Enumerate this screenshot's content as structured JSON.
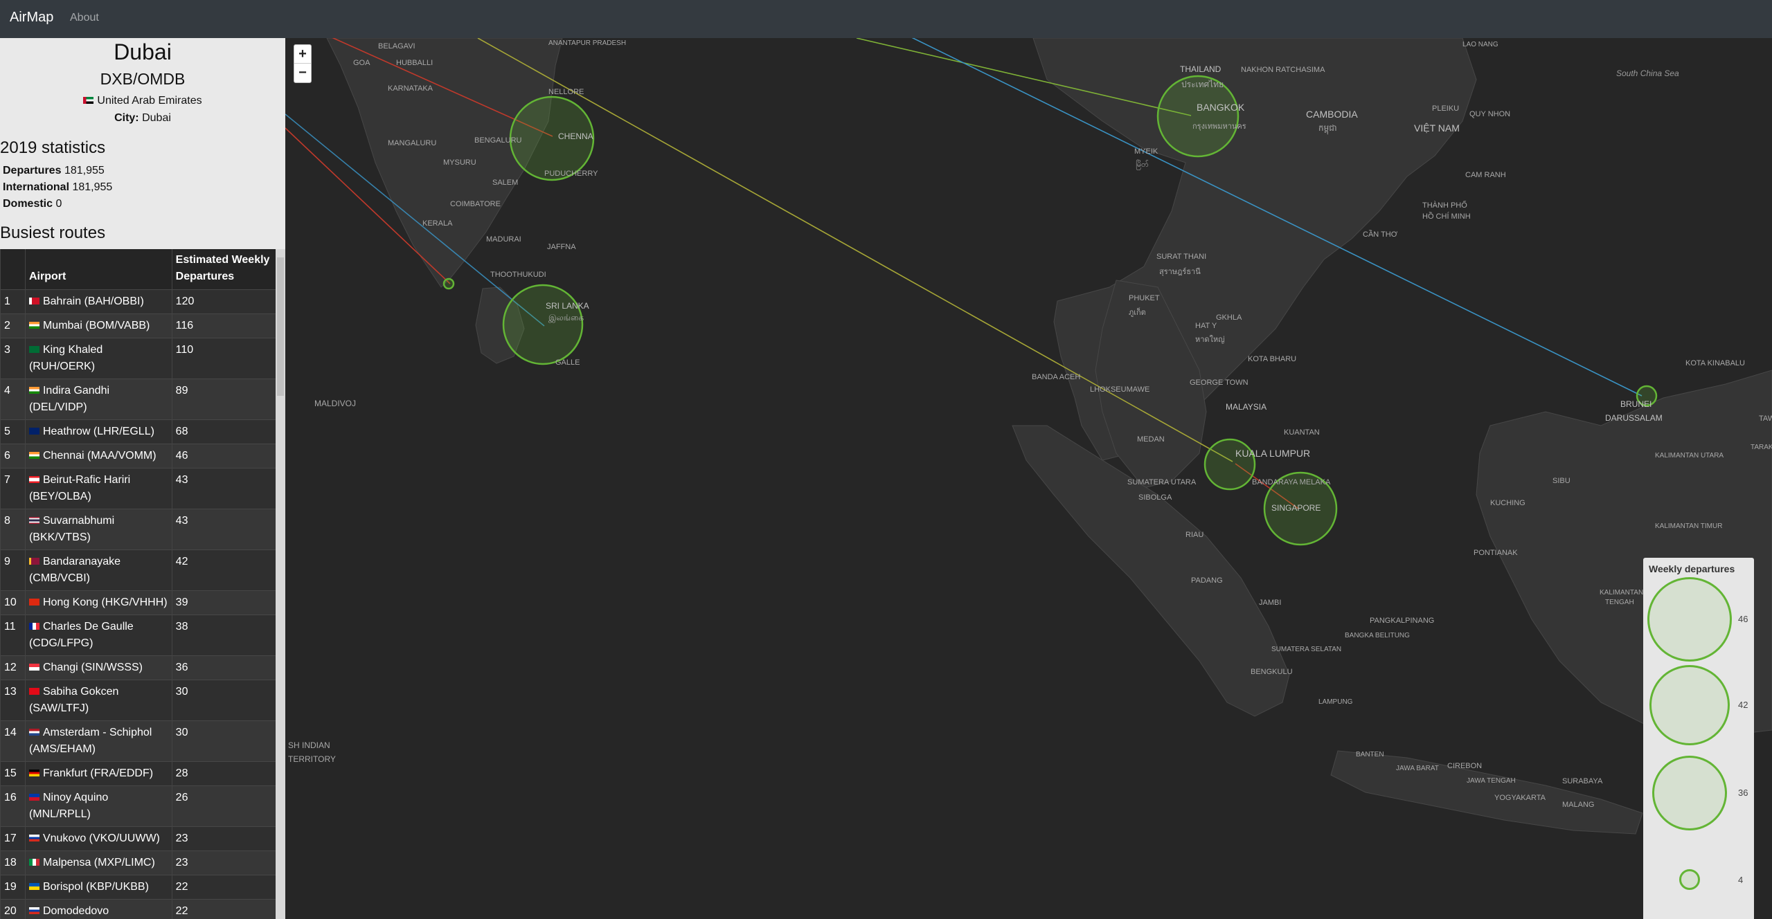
{
  "navbar": {
    "brand": "AirMap",
    "about": "About"
  },
  "airport": {
    "name": "Dubai",
    "codes": "DXB/OMDB",
    "country": "United Arab Emirates",
    "city_label": "City:",
    "city": "Dubai"
  },
  "stats": {
    "title": "2019 statistics",
    "departures_label": "Departures",
    "departures": "181,955",
    "international_label": "International",
    "international": "181,955",
    "domestic_label": "Domestic",
    "domestic": "0"
  },
  "routes": {
    "title": "Busiest routes",
    "col_airport": "Airport",
    "col_departures_1": "Estimated Weekly",
    "col_departures_2": "Departures",
    "rows": [
      {
        "rank": "1",
        "airport": "Bahrain (BAH/OBBI)",
        "departures": "120"
      },
      {
        "rank": "2",
        "airport": "Mumbai (BOM/VABB)",
        "departures": "116"
      },
      {
        "rank": "3",
        "airport": "King Khaled (RUH/OERK)",
        "departures": "110"
      },
      {
        "rank": "4",
        "airport": "Indira Gandhi (DEL/VIDP)",
        "departures": "89"
      },
      {
        "rank": "5",
        "airport": "Heathrow (LHR/EGLL)",
        "departures": "68"
      },
      {
        "rank": "6",
        "airport": "Chennai (MAA/VOMM)",
        "departures": "46"
      },
      {
        "rank": "7",
        "airport": "Beirut-Rafic Hariri (BEY/OLBA)",
        "departures": "43"
      },
      {
        "rank": "8",
        "airport": "Suvarnabhumi (BKK/VTBS)",
        "departures": "43"
      },
      {
        "rank": "9",
        "airport": "Bandaranayake (CMB/VCBI)",
        "departures": "42"
      },
      {
        "rank": "10",
        "airport": "Hong Kong (HKG/VHHH)",
        "departures": "39"
      },
      {
        "rank": "11",
        "airport": "Charles De Gaulle (CDG/LFPG)",
        "departures": "38"
      },
      {
        "rank": "12",
        "airport": "Changi (SIN/WSSS)",
        "departures": "36"
      },
      {
        "rank": "13",
        "airport": "Sabiha Gokcen (SAW/LTFJ)",
        "departures": "30"
      },
      {
        "rank": "14",
        "airport": "Amsterdam - Schiphol (AMS/EHAM)",
        "departures": "30"
      },
      {
        "rank": "15",
        "airport": "Frankfurt (FRA/EDDF)",
        "departures": "28"
      },
      {
        "rank": "16",
        "airport": "Ninoy Aquino (MNL/RPLL)",
        "departures": "26"
      },
      {
        "rank": "17",
        "airport": "Vnukovo (VKO/UUWW)",
        "departures": "23"
      },
      {
        "rank": "18",
        "airport": "Malpensa (MXP/LIMC)",
        "departures": "23"
      },
      {
        "rank": "19",
        "airport": "Borispol (KBP/UKBB)",
        "departures": "22"
      },
      {
        "rank": "20",
        "airport": "Domodedovo (DME/UUDD)",
        "departures": "22"
      }
    ]
  },
  "map": {
    "zoom_in": "+",
    "zoom_out": "−",
    "places": {
      "belagavi": "BELAGAVI",
      "anantapur": "ANANTAPUR PRADESH",
      "goa": "GOA",
      "hubballi": "HUBBALLI",
      "karnataka": "KARNATAKA",
      "nellore": "NELLORE",
      "mangaluru": "MANGALURU",
      "bengaluru": "BENGALURU",
      "chennai": "CHENNA",
      "mysuru": "MYSURU",
      "salem": "SALEM",
      "puducherry": "PUDUCHERRY",
      "coimbatore": "COIMBATORE",
      "kerala": "KERALA",
      "madurai": "MADURAI",
      "jaffna": "JAFFNA",
      "thoothukudi": "THOOTHUKUDI",
      "srilanka": "SRI LANKA",
      "srilanka_local": "இலங்கை",
      "galle": "GALLE",
      "maldivo": "MALDIVOJ",
      "biot1": "SH INDIAN",
      "biot2": "TERRITORY",
      "thailand": "THAILAND",
      "thailand_local": "ประเทศไทย",
      "nakhon": "NAKHON RATCHASIMA",
      "bangkok": "BANGKOK",
      "bangkok_local": "กรุงเทพมหานคร",
      "cambodia": "CAMBODIA",
      "cambodia_local": "កម្ពុជា",
      "pleiku": "PLEIKU",
      "quynhon": "QUY NHON",
      "vietnam": "VIỆT NAM",
      "laos": "LAO NANG",
      "camranh": "CAM RANH",
      "myeik": "MYEIK",
      "myeik_local": "မြိတ်",
      "thanhpho1": "THÀNH PHỐ",
      "thanhpho2": "HỒ CHÍ MINH",
      "canthe": "CẦN THƠ",
      "suratthani": "SURAT THANI",
      "suratthani_local": "สุราษฎร์ธานี",
      "phuket": "PHUKET",
      "phuket_local": "ภูเก็ต",
      "hatyai": "HAT Y",
      "hatyai_local": "หาดใหญ่",
      "songkhla": "GKHLA",
      "kotabharu": "KOTA BHARU",
      "georgetown": "GEORGE TOWN",
      "malaysia": "MALAYSIA",
      "bandaaceh": "BANDA ACEH",
      "lhokseumawe": "LHOKSEUMAWE",
      "kuantan": "KUANTAN",
      "medan": "MEDAN",
      "kualalumpur": "KUALA LUMPUR",
      "bandaraya": "BANDARAYA MELAKA",
      "singapore": "SINGAPORE",
      "sumatera_utara": "SUMATERA UTARA",
      "sibolga": "SIBOLGA",
      "riau": "RIAU",
      "padang": "PADANG",
      "jambi": "JAMBI",
      "pangkalpinang": "PANGKALPINANG",
      "bangka": "BANGKA BELITUNG",
      "sumatera_selatan": "SUMATERA SELATAN",
      "bengkulu": "BENGKULU",
      "lampung": "LAMPUNG",
      "banten": "BANTEN",
      "cirebon": "CIREBON",
      "jawabarat": "JAWA BARAT",
      "jawatengah": "JAWA TENGAH",
      "surabaya": "SURABAYA",
      "yogyakarta": "YOGYAKARTA",
      "malang": "MALANG",
      "southchinasea": "South China Sea",
      "brunei": "BRUNEI",
      "darussalam": "DARUSSALAM",
      "kotakinabalu": "KOTA KINABALU",
      "kalimantan_utara": "KALIMANTAN UTARA",
      "sibu": "SIBU",
      "kuching": "KUCHING",
      "kalimantan_timur": "KALIMANTAN TIMUR",
      "pontianak": "PONTIANAK",
      "kalimantan_tengah1": "KALIMANTAN",
      "kalimantan_tengah2": "TENGAH",
      "tawau": "TAWA",
      "tarakan": "TARAKAN"
    }
  },
  "legend": {
    "title": "Weekly departures",
    "levels": [
      "46",
      "42",
      "36",
      "4"
    ]
  },
  "colors": {
    "marker": "#63b535",
    "route_red": "#c0392b",
    "route_blue": "#3a93c4",
    "route_yellow": "#a6a636",
    "route_green": "#7fb236"
  }
}
